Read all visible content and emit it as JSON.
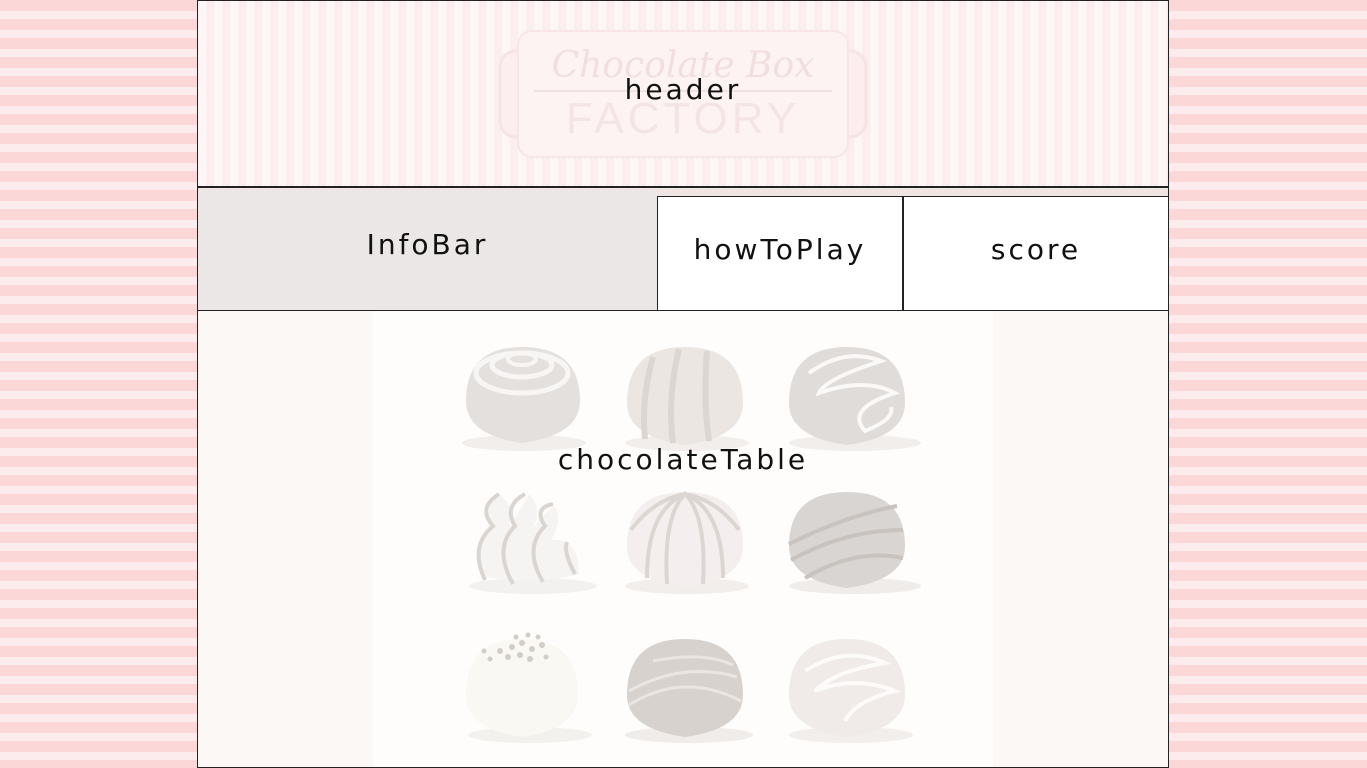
{
  "logo": {
    "line1": "Chocolate Box",
    "line2": "FACTORY"
  },
  "header": {
    "label": "header"
  },
  "infobar": {
    "label": "InfoBar"
  },
  "howtoplay": {
    "label": "howToPlay"
  },
  "score": {
    "label": "score"
  },
  "table": {
    "label": "chocolateTable",
    "chocolates": [
      {
        "name": "chocolate-swirl-top"
      },
      {
        "name": "chocolate-stripes"
      },
      {
        "name": "chocolate-zigzag"
      },
      {
        "name": "chocolate-wavy"
      },
      {
        "name": "chocolate-pink-arcs"
      },
      {
        "name": "chocolate-dark-drizzle"
      },
      {
        "name": "chocolate-sprinkles"
      },
      {
        "name": "chocolate-dark-stripes"
      },
      {
        "name": "chocolate-light-swirl"
      }
    ]
  }
}
